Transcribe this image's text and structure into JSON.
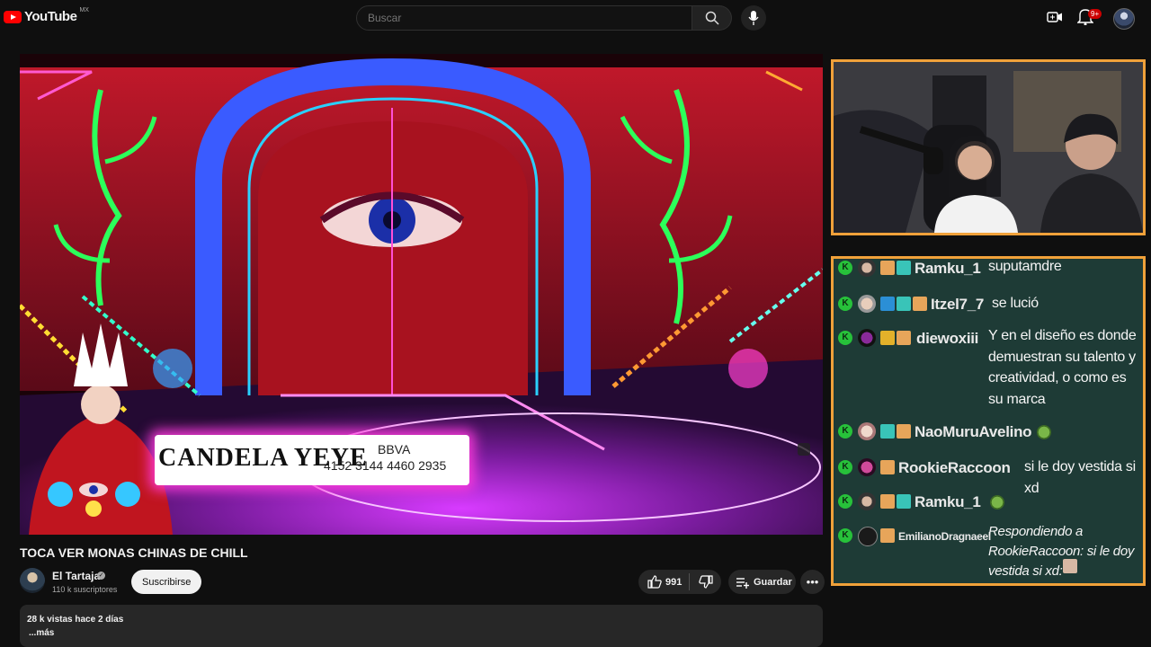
{
  "header": {
    "logo_text": "YouTube",
    "country": "MX",
    "search_placeholder": "Buscar",
    "notifications_badge": "9+"
  },
  "video": {
    "title": "TOCA VER MONAS CHINAS DE CHILL",
    "lower_third": {
      "name": "CANDELA YEYE",
      "bank": "BBVA",
      "account": "4152 3144 4460 2935"
    }
  },
  "channel": {
    "name": "El Tartaja",
    "subscribers": "110 k suscriptores",
    "subscribe_label": "Suscribirse"
  },
  "actions": {
    "likes": "991",
    "save_label": "Guardar"
  },
  "description": {
    "meta": "28 k vistas  hace 2 días",
    "more": "...más"
  },
  "chat": {
    "messages": [
      {
        "user": "Ramku_1",
        "text": "suputamdre"
      },
      {
        "user": "Itzel7_7",
        "text": "se lució"
      },
      {
        "user": "diewoxiii",
        "text": "Y en el diseño es donde demuestran su talento y creatividad, o como es su marca"
      },
      {
        "user": "NaoMuruAvelino",
        "text": ""
      },
      {
        "user": "RookieRaccoon",
        "text": "si le doy vestida si xd"
      },
      {
        "user": "Ramku_1",
        "text": ""
      },
      {
        "user": "EmilianoDragnaeel",
        "text": "Respondiendo a RookieRaccoon: si le doy vestida si xd:"
      }
    ],
    "badge_letter": "K"
  },
  "colors": {
    "brand_red": "#ff0000",
    "frame_orange": "#f0a13a",
    "chat_bg": "#1e3b36",
    "kick_green": "#27c13a"
  }
}
